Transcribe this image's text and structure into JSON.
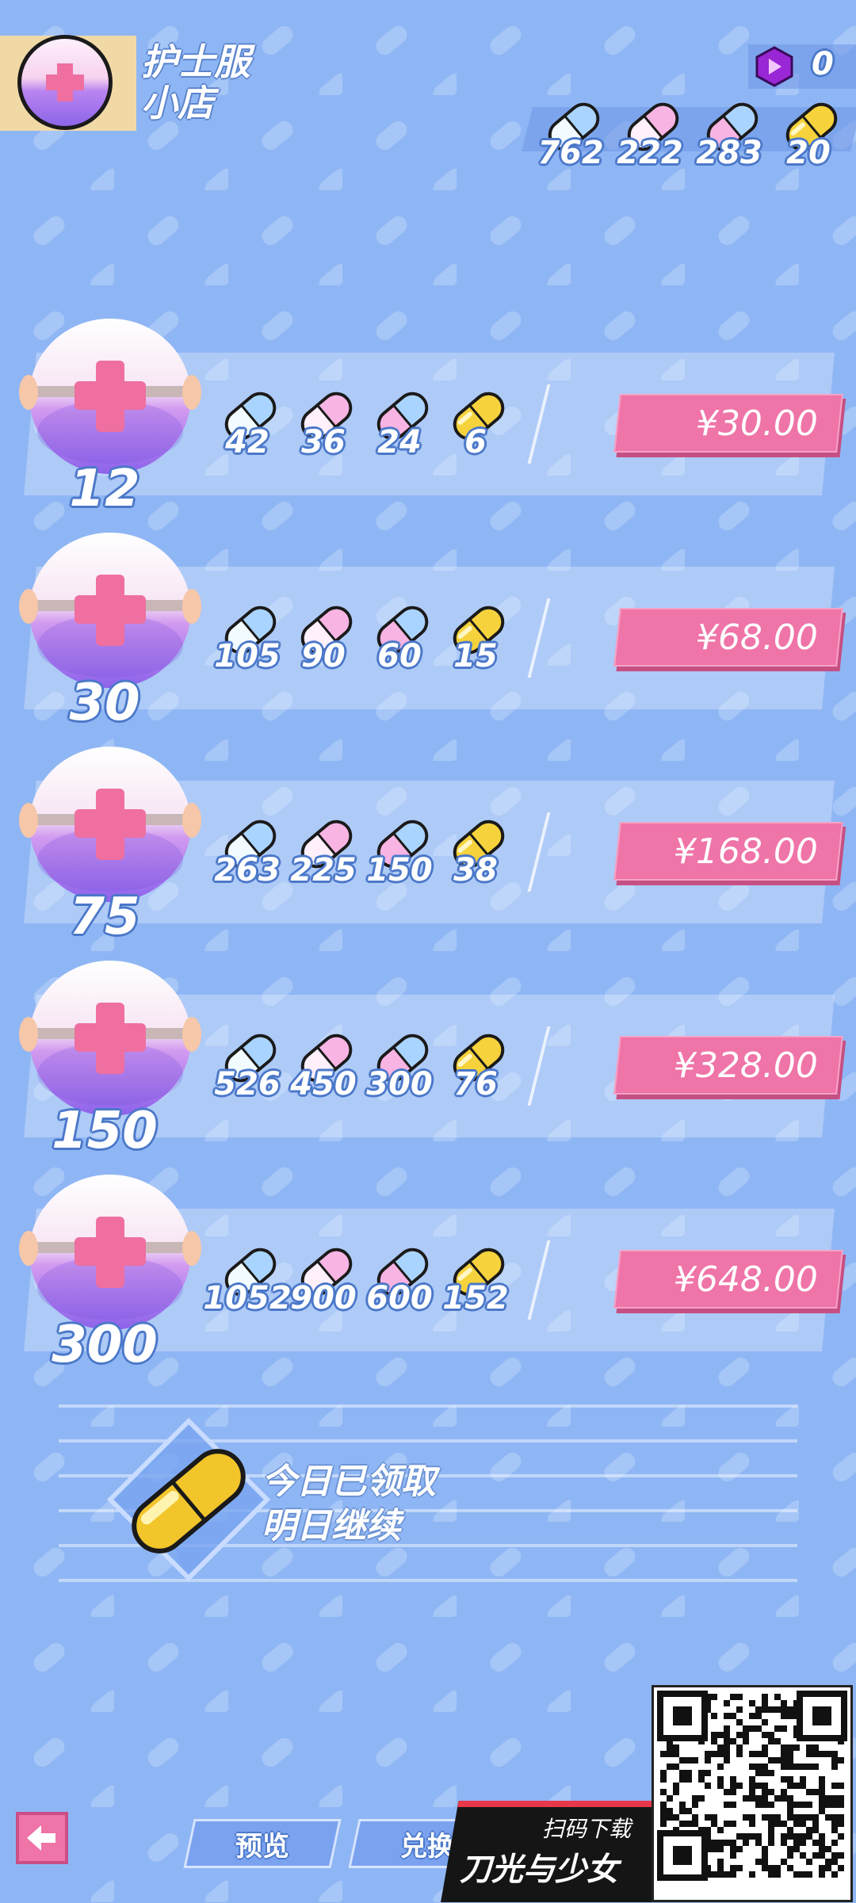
{
  "shop": {
    "title_line1": "护士服",
    "title_line2": "小店",
    "gem_count": "0"
  },
  "inventory": [
    {
      "color": "blue",
      "count": "762"
    },
    {
      "color": "pink",
      "count": "222"
    },
    {
      "color": "pinkblue",
      "count": "283"
    },
    {
      "color": "gold",
      "count": "20"
    }
  ],
  "packages": [
    {
      "caps": "12",
      "pills": [
        "42",
        "36",
        "24",
        "6"
      ],
      "price": "¥30.00"
    },
    {
      "caps": "30",
      "pills": [
        "105",
        "90",
        "60",
        "15"
      ],
      "price": "¥68.00"
    },
    {
      "caps": "75",
      "pills": [
        "263",
        "225",
        "150",
        "38"
      ],
      "price": "¥168.00"
    },
    {
      "caps": "150",
      "pills": [
        "526",
        "450",
        "300",
        "76"
      ],
      "price": "¥328.00"
    },
    {
      "caps": "300",
      "pills": [
        "1052",
        "900",
        "600",
        "152"
      ],
      "price": "¥648.00"
    }
  ],
  "daily": {
    "line1": "今日已领取",
    "line2": "明日继续"
  },
  "bottom": {
    "preview_label": "预览",
    "exchange_label": "兑换",
    "promo_scan": "扫码下载",
    "promo_name": "刀光与少女"
  },
  "colors": {
    "background": "#8fb6f4",
    "accent_pink": "#ef74a8",
    "pill_blue": "#a9d4ff",
    "pill_pink": "#f8b4e3",
    "pill_gold": "#f6d23c"
  }
}
